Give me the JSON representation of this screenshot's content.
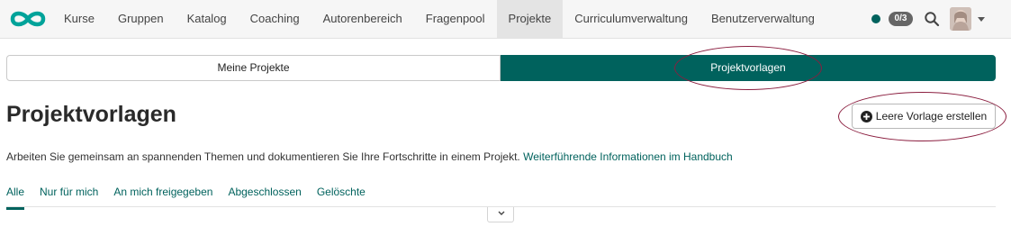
{
  "topnav": {
    "logo": "infinity-logo-icon",
    "items": [
      {
        "label": "Kurse"
      },
      {
        "label": "Gruppen"
      },
      {
        "label": "Katalog"
      },
      {
        "label": "Coaching"
      },
      {
        "label": "Autorenbereich"
      },
      {
        "label": "Fragenpool"
      },
      {
        "label": "Projekte",
        "active": true
      },
      {
        "label": "Curriculumverwaltung"
      },
      {
        "label": "Benutzerverwaltung"
      }
    ],
    "notification_badge": "0/3",
    "status_color": "#00625d"
  },
  "segmented": {
    "mine_label": "Meine Projekte",
    "templates_label": "Projektvorlagen"
  },
  "page": {
    "title": "Projektvorlagen",
    "create_button_label": "Leere Vorlage erstellen",
    "description": "Arbeiten Sie gemeinsam an spannenden Themen und dokumentieren Sie Ihre Fortschritte in einem Projekt.",
    "handbook_link": "Weiterführende Informationen im Handbuch"
  },
  "tabs": [
    {
      "label": "Alle",
      "active": true
    },
    {
      "label": "Nur für mich"
    },
    {
      "label": "An mich freigegeben"
    },
    {
      "label": "Abgeschlossen"
    },
    {
      "label": "Gelöschte"
    }
  ],
  "colors": {
    "accent": "#00625d",
    "annotation": "#8b1e3f"
  }
}
